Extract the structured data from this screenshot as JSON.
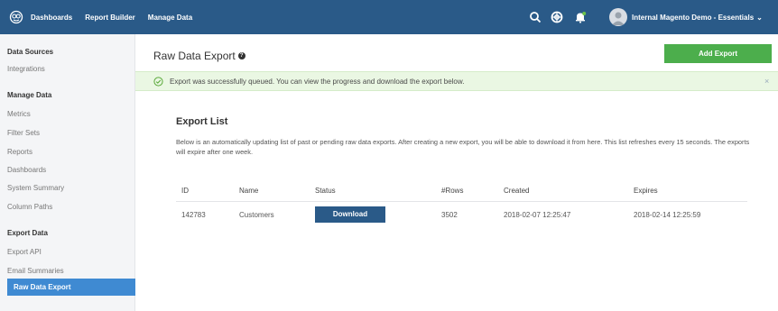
{
  "topbar": {
    "logo_icon": "logo-icon",
    "nav": [
      "Dashboards",
      "Report Builder",
      "Manage Data"
    ],
    "icons": [
      "search-icon",
      "support-icon",
      "notification-icon"
    ],
    "account_label": "Internal Magento Demo - Essentials",
    "chevron": "⌄",
    "bg_color": "#2a5a88"
  },
  "sidebar": {
    "sections": [
      {
        "heading": "Data Sources",
        "items": [
          "Integrations"
        ]
      },
      {
        "heading": "Manage Data",
        "items": [
          "Metrics",
          "Filter Sets",
          "Reports",
          "Dashboards",
          "System Summary",
          "Column Paths"
        ]
      },
      {
        "heading": "Export Data",
        "items": [
          "Export API",
          "Email Summaries",
          "Raw Data Export"
        ]
      }
    ],
    "active_item": "Raw Data Export",
    "active_color": "#3f8ad2"
  },
  "main": {
    "title": "Raw Data Export",
    "help_glyph": "?",
    "add_button": "Add Export",
    "alert": {
      "message": "Export was successfully queued. You can view the progress and download the export below.",
      "close": "×"
    },
    "list_title": "Export List",
    "description": "Below is an automatically updating list of past or pending raw data exports. After creating a new export, you will be able to download it from here. This list refreshes every 15 seconds. The exports will expire after one week.",
    "table": {
      "columns": [
        "ID",
        "Name",
        "Status",
        "#Rows",
        "Created",
        "Expires"
      ],
      "rows": [
        {
          "id": "142783",
          "name": "Customers",
          "status": "Download",
          "rows": "3502",
          "created": "2018-02-07 12:25:47",
          "expires": "2018-02-14 12:25:59"
        }
      ]
    }
  }
}
